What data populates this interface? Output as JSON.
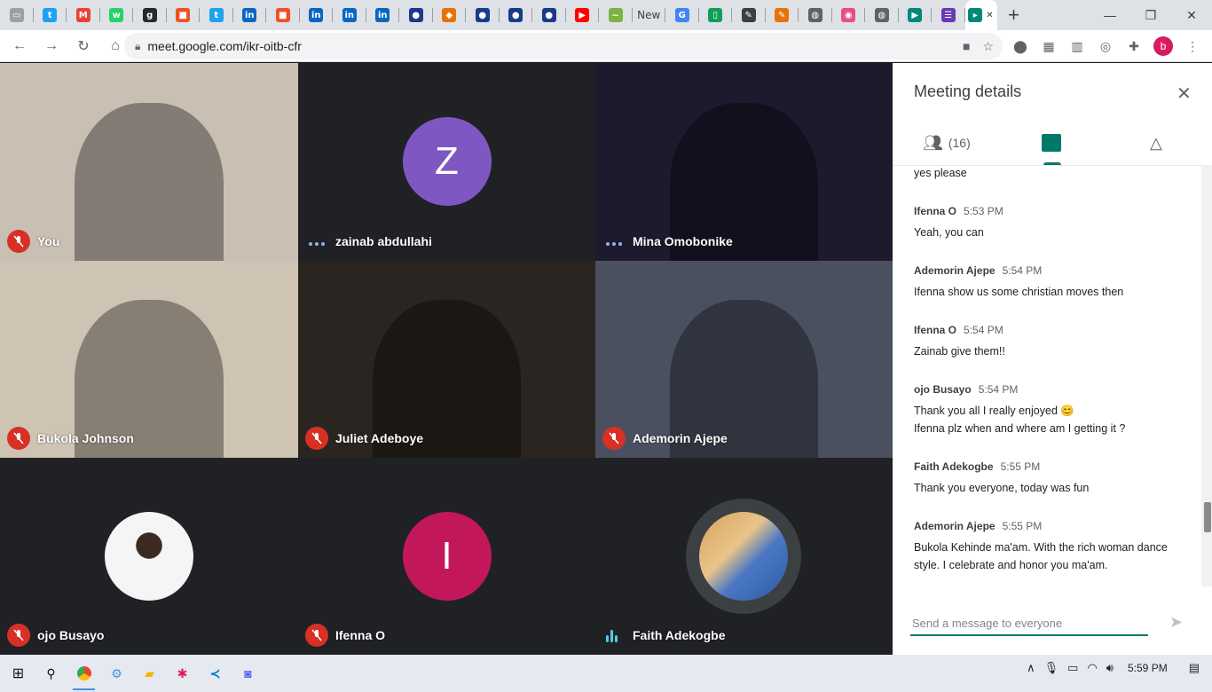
{
  "browser": {
    "tabs": [
      {
        "icon": "generic-page-icon",
        "color": "#9aa0a6",
        "glyph": "▭"
      },
      {
        "icon": "twitter-icon",
        "color": "#1da1f2",
        "glyph": "t"
      },
      {
        "icon": "gmail-icon",
        "color": "#ea4335",
        "glyph": "M"
      },
      {
        "icon": "whatsapp-icon",
        "color": "#25d366",
        "glyph": "w"
      },
      {
        "icon": "github-icon",
        "color": "#24292e",
        "glyph": "g"
      },
      {
        "icon": "microsoft-icon",
        "color": "#f25022",
        "glyph": "■"
      },
      {
        "icon": "twitter-icon",
        "color": "#1da1f2",
        "glyph": "t"
      },
      {
        "icon": "linkedin-icon",
        "color": "#0a66c2",
        "glyph": "in"
      },
      {
        "icon": "microsoft-icon",
        "color": "#f25022",
        "glyph": "■"
      },
      {
        "icon": "linkedin-icon",
        "color": "#0a66c2",
        "glyph": "in"
      },
      {
        "icon": "linkedin-icon",
        "color": "#0a66c2",
        "glyph": "in"
      },
      {
        "icon": "linkedin-icon",
        "color": "#0a66c2",
        "glyph": "in"
      },
      {
        "icon": "circle-logo-icon",
        "color": "#1a3a8a",
        "glyph": "●"
      },
      {
        "icon": "shield-logo-icon",
        "color": "#e8710a",
        "glyph": "◆"
      },
      {
        "icon": "circle-logo-icon",
        "color": "#1a3a8a",
        "glyph": "●"
      },
      {
        "icon": "circle-logo-icon",
        "color": "#1a3a8a",
        "glyph": "●"
      },
      {
        "icon": "circle-logo-icon",
        "color": "#1a3a8a",
        "glyph": "●"
      },
      {
        "icon": "youtube-icon",
        "color": "#ff0000",
        "glyph": "▶"
      },
      {
        "icon": "leaf-icon",
        "color": "#7cb342",
        "glyph": "~"
      },
      {
        "icon": "new-tab-text",
        "color": "#3c4043",
        "glyph": "New"
      },
      {
        "icon": "google-icon",
        "color": "#4285f4",
        "glyph": "G"
      },
      {
        "icon": "sheets-icon",
        "color": "#0f9d58",
        "glyph": "▯"
      },
      {
        "icon": "pen-icon",
        "color": "#3c4043",
        "glyph": "✎"
      },
      {
        "icon": "pen-icon",
        "color": "#e8710a",
        "glyph": "✎"
      },
      {
        "icon": "globe-icon",
        "color": "#5f6368",
        "glyph": "◍"
      },
      {
        "icon": "dribbble-icon",
        "color": "#ea4c89",
        "glyph": "◉"
      },
      {
        "icon": "globe-icon",
        "color": "#5f6368",
        "glyph": "◍"
      },
      {
        "icon": "meet-icon",
        "color": "#00897b",
        "glyph": "▶"
      },
      {
        "icon": "forms-icon",
        "color": "#673ab7",
        "glyph": "☰"
      },
      {
        "icon": "meet-active-icon",
        "color": "#00897b",
        "glyph": "▸"
      }
    ],
    "url": "meet.google.com/ikr-oitb-cfr",
    "profile_initial": "b"
  },
  "meeting": {
    "participants": [
      {
        "name": "You",
        "status": "muted",
        "bg": "#c9bfb3"
      },
      {
        "name": "zainab abdullahi",
        "status": "speaking-dots",
        "bg": "#202124",
        "initial": "Z",
        "avatar_color": "#7e57c2"
      },
      {
        "name": "Mina Omobonike",
        "status": "speaking-dots",
        "bg": "#1e1a2e"
      },
      {
        "name": "Bukola Johnson",
        "status": "muted",
        "bg": "#cfc3b3"
      },
      {
        "name": "Juliet Adeboye",
        "status": "muted",
        "bg": "#2a2520"
      },
      {
        "name": "Ademorin Ajepe",
        "status": "muted",
        "bg": "#4a5060"
      },
      {
        "name": "ojo Busayo",
        "status": "muted",
        "bg": "#202124"
      },
      {
        "name": "Ifenna O",
        "status": "muted",
        "bg": "#202124",
        "initial": "I",
        "avatar_color": "#c2185b"
      },
      {
        "name": "Faith Adekogbe",
        "status": "speaking-bars",
        "bg": "#202124"
      }
    ]
  },
  "panel": {
    "title": "Meeting details",
    "people_count": "(16)",
    "messages": [
      {
        "sender": "",
        "time": "",
        "lines": [
          "yes please"
        ]
      },
      {
        "sender": "Ifenna O",
        "time": "5:53 PM",
        "lines": [
          "Yeah, you can"
        ]
      },
      {
        "sender": "Ademorin Ajepe",
        "time": "5:54 PM",
        "lines": [
          "Ifenna show us some christian moves then"
        ]
      },
      {
        "sender": "Ifenna O",
        "time": "5:54 PM",
        "lines": [
          "Zainab give them!!"
        ]
      },
      {
        "sender": "ojo Busayo",
        "time": "5:54 PM",
        "lines": [
          "Thank you all I really enjoyed 😊",
          "Ifenna plz when and where am I getting it ?"
        ]
      },
      {
        "sender": "Faith Adekogbe",
        "time": "5:55 PM",
        "lines": [
          "Thank you everyone, today was fun"
        ]
      },
      {
        "sender": "Ademorin Ajepe",
        "time": "5:55 PM",
        "lines": [
          "Bukola Kehinde ma'am. With the rich woman dance style. I celebrate and honor you ma'am."
        ]
      }
    ],
    "input_placeholder": "Send a message to everyone"
  },
  "taskbar": {
    "clock": "5:59 PM"
  }
}
